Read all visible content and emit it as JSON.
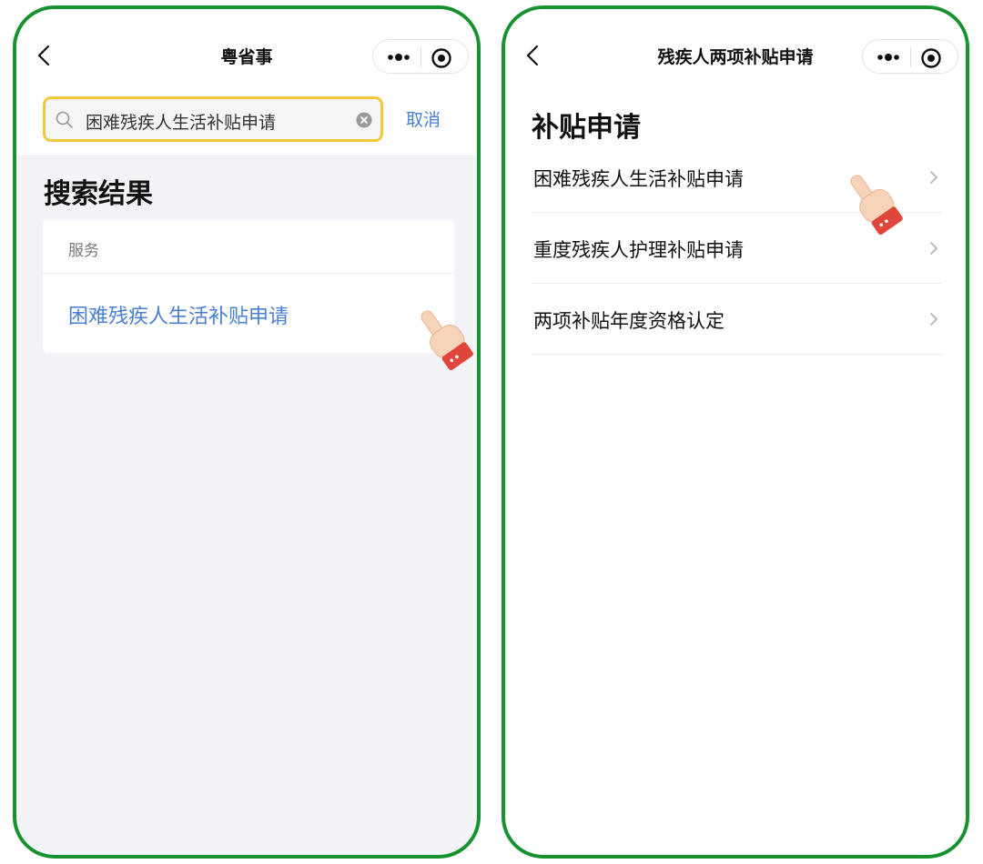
{
  "left": {
    "nav_title": "粤省事",
    "search": {
      "value": "困难残疾人生活补贴申请",
      "cancel_label": "取消"
    },
    "section_title": "搜索结果",
    "card": {
      "label": "服务",
      "result": "困难残疾人生活补贴申请"
    }
  },
  "right": {
    "nav_title": "残疾人两项补贴申请",
    "heading": "补贴申请",
    "items": [
      {
        "label": "困难残疾人生活补贴申请"
      },
      {
        "label": "重度残疾人护理补贴申请"
      },
      {
        "label": "两项补贴年度资格认定"
      }
    ]
  },
  "colors": {
    "frame": "#17922f",
    "accent_blue": "#4a7fd1",
    "search_border": "#f2c83a",
    "page_bg": "#f3f4f7",
    "hand_cuff": "#e0463a"
  },
  "icons": [
    "back-arrow-icon",
    "more-dots-icon",
    "close-target-icon",
    "search-icon",
    "clear-icon",
    "chevron-right-icon",
    "pointing-hand-icon"
  ]
}
